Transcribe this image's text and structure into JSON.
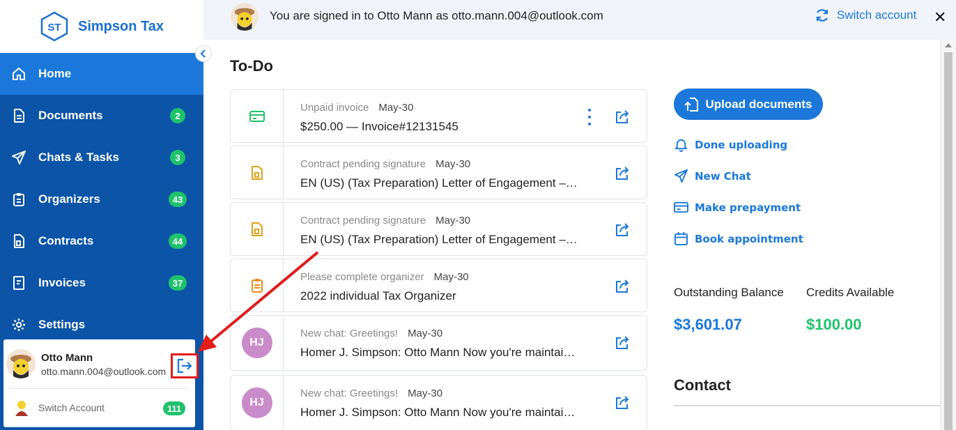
{
  "brand": {
    "initials": "ST",
    "name": "Simpson Tax"
  },
  "sidebar": {
    "items": [
      {
        "label": "Home",
        "icon": "home-icon",
        "badge": null
      },
      {
        "label": "Documents",
        "icon": "document-icon",
        "badge": "2"
      },
      {
        "label": "Chats & Tasks",
        "icon": "send-icon",
        "badge": "3"
      },
      {
        "label": "Organizers",
        "icon": "clipboard-icon",
        "badge": "43"
      },
      {
        "label": "Contracts",
        "icon": "contract-icon",
        "badge": "44"
      },
      {
        "label": "Invoices",
        "icon": "invoice-icon",
        "badge": "37"
      },
      {
        "label": "Settings",
        "icon": "gear-icon",
        "badge": null
      }
    ]
  },
  "user": {
    "name": "Otto Mann",
    "email": "otto.mann.004@outlook.com",
    "switch_label": "Switch Account",
    "switch_badge": "111"
  },
  "topbar": {
    "signed_in_text": "You are signed in to Otto Mann as otto.mann.004@outlook.com",
    "switch_account": "Switch account",
    "close": "✕"
  },
  "todo": {
    "title": "To-Do",
    "items": [
      {
        "type": "Unpaid invoice",
        "date": "May-30",
        "desc": "$250.00 — Invoice#12131545",
        "icon": "credit-card-icon",
        "has_menu": true
      },
      {
        "type": "Contract pending signature",
        "date": "May-30",
        "desc": "EN (US) (Tax Preparation) Letter of Engagement – Fin…",
        "icon": "contract-icon",
        "has_menu": false
      },
      {
        "type": "Contract pending signature",
        "date": "May-30",
        "desc": "EN (US) (Tax Preparation) Letter of Engagement – Fin…",
        "icon": "contract-icon",
        "has_menu": false
      },
      {
        "type": "Please complete organizer",
        "date": "May-30",
        "desc": "2022 individual Tax Organizer",
        "icon": "clipboard-icon",
        "has_menu": false
      },
      {
        "type": "New chat: Greetings!",
        "date": "May-30",
        "desc": "Homer J. Simpson: Otto Mann Now you're maintaini…",
        "icon": "HJ",
        "has_menu": false
      },
      {
        "type": "New chat: Greetings!",
        "date": "May-30",
        "desc": "Homer J. Simpson: Otto Mann Now you're maintaini…",
        "icon": "HJ",
        "has_menu": false
      }
    ]
  },
  "actions": {
    "upload": "Upload documents",
    "done_uploading": "Done uploading",
    "new_chat": "New Chat",
    "make_prepayment": "Make prepayment",
    "book_appointment": "Book appointment"
  },
  "balance": {
    "outstanding_label": "Outstanding Balance",
    "outstanding_value": "$3,601.07",
    "credits_label": "Credits Available",
    "credits_value": "$100.00"
  },
  "contact": {
    "title": "Contact"
  },
  "colors": {
    "sidebar": "#0b54a8",
    "active": "#1b78da",
    "badge": "#1fc26b",
    "accent": "#1b78da",
    "annotation": "#e21b1b"
  }
}
